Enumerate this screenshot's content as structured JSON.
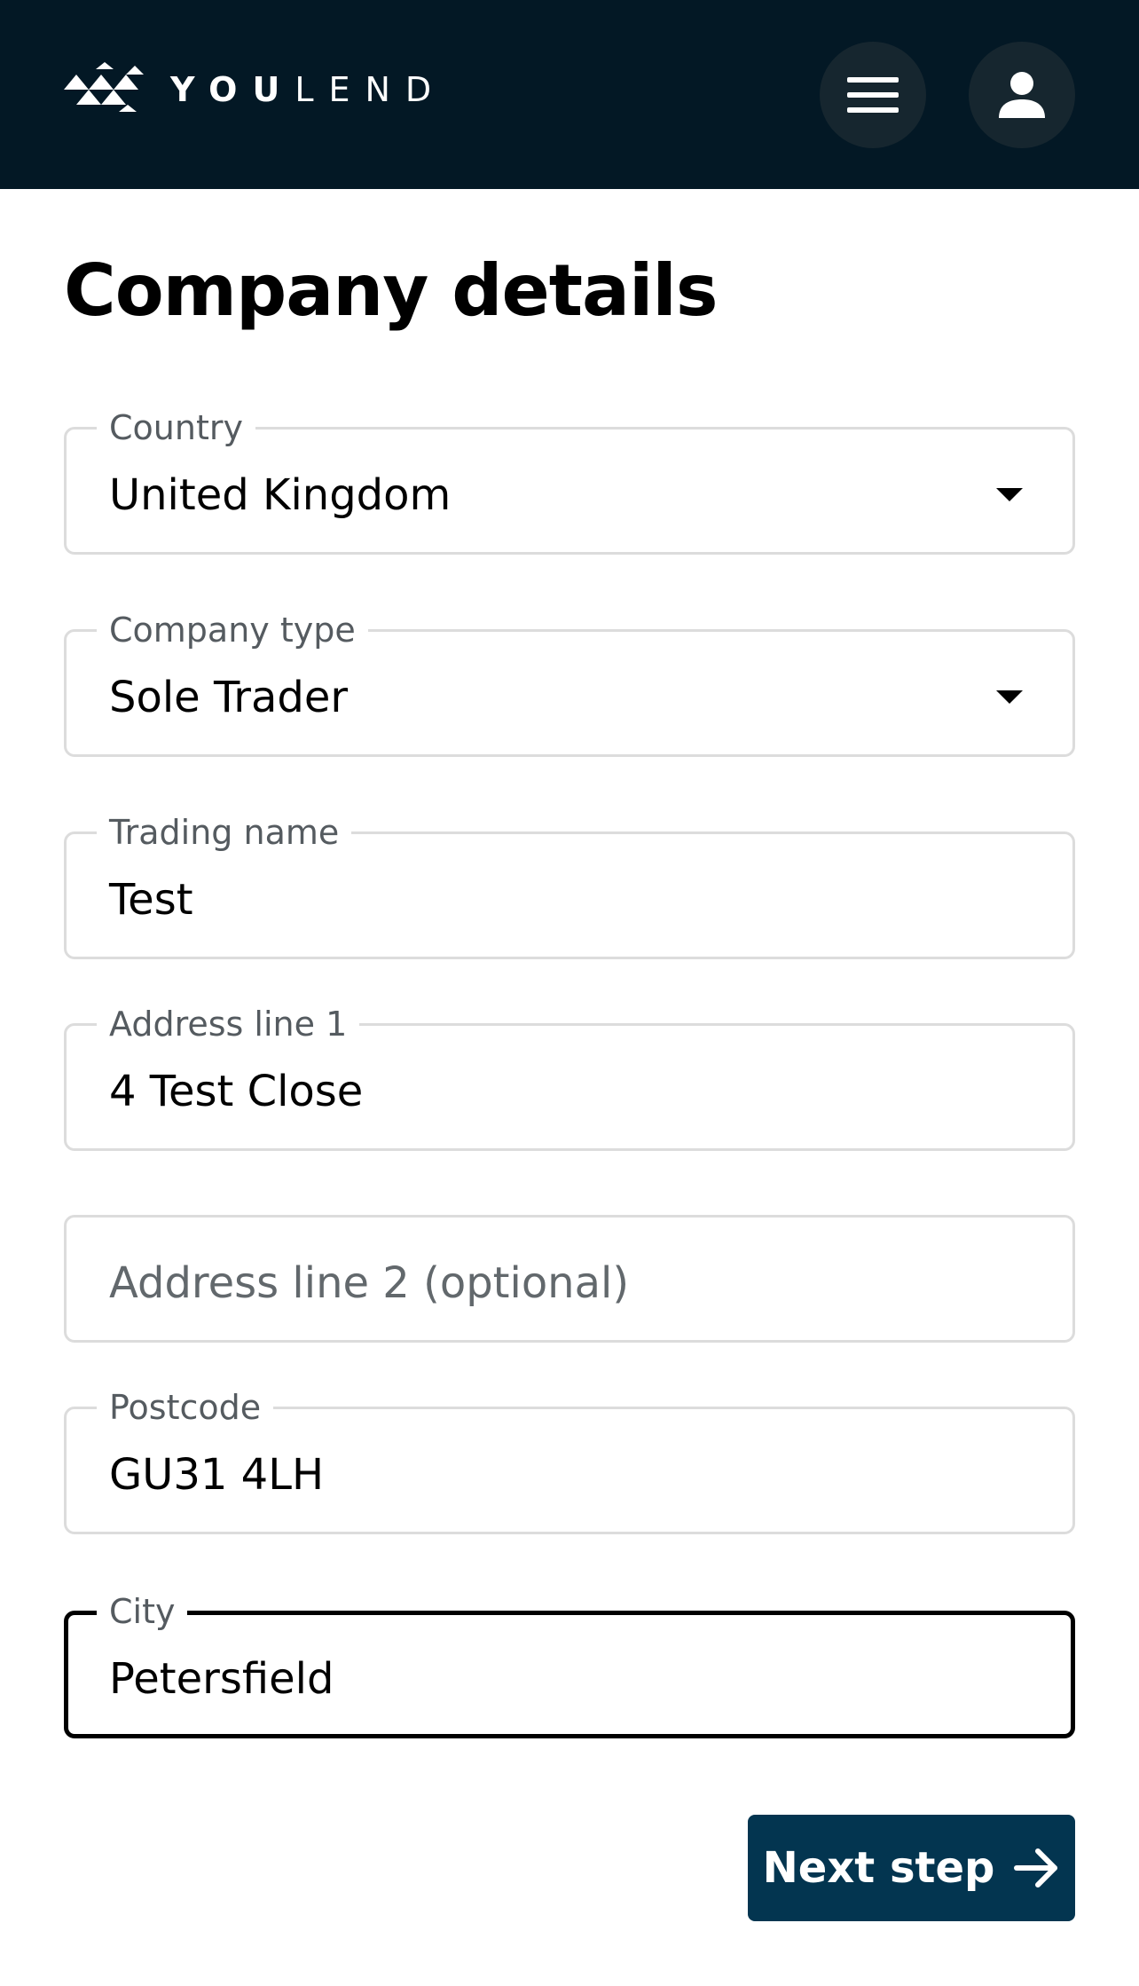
{
  "header": {
    "logo_text_bold": "YOU",
    "logo_text_light": "LEND",
    "menu_icon": "hamburger-menu-icon",
    "account_icon": "user-icon",
    "background_color": "#031825"
  },
  "page": {
    "title": "Company details"
  },
  "form": {
    "country": {
      "label": "Country",
      "value": "United Kingdom"
    },
    "company_type": {
      "label": "Company type",
      "value": "Sole Trader"
    },
    "trading_name": {
      "label": "Trading name",
      "value": "Test"
    },
    "address_line_1": {
      "label": "Address line 1",
      "value": "4 Test Close"
    },
    "address_line_2": {
      "placeholder": "Address line 2 (optional)",
      "value": ""
    },
    "postcode": {
      "label": "Postcode",
      "value": "GU31 4LH"
    },
    "city": {
      "label": "City",
      "value": "Petersfield",
      "focused": true
    }
  },
  "actions": {
    "next_label": "Next step",
    "next_icon": "arrow-right-icon",
    "button_color": "#033550"
  }
}
